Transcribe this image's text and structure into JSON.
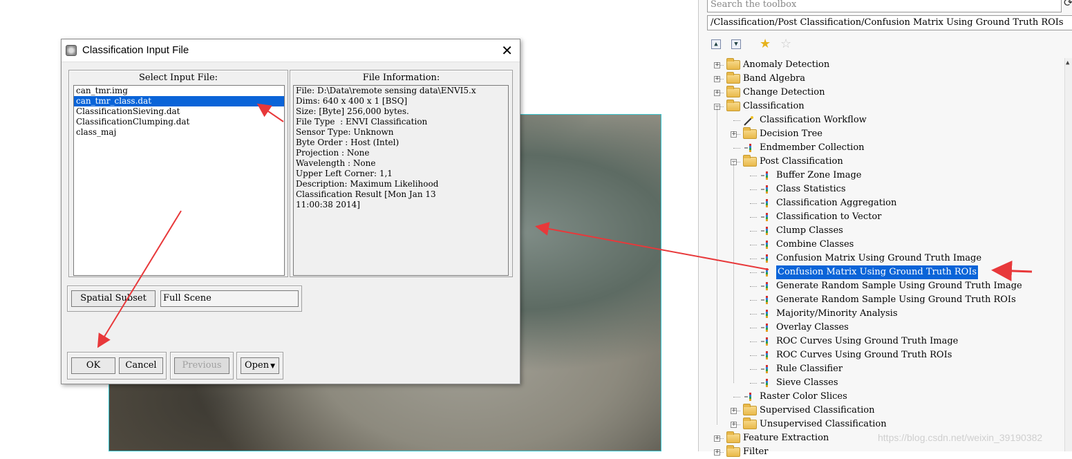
{
  "dialog": {
    "title": "Classification Input File",
    "select_header": "Select Input File:",
    "files": [
      "can_tmr.img",
      "can_tmr_class.dat",
      "ClassificationSieving.dat",
      "ClassificationClumping.dat",
      "class_maj"
    ],
    "selected_index": 1,
    "info_header": "File Information:",
    "info_lines": [
      "File: D:\\Data\\remote sensing data\\ENVI5.x",
      "Dims: 640 x 400 x 1 [BSQ]",
      "Size: [Byte] 256,000 bytes.",
      "File Type  : ENVI Classification",
      "Sensor Type: Unknown",
      "Byte Order : Host (Intel)",
      "Projection : None",
      "Wavelength : None",
      "Upper Left Corner: 1,1",
      "Description: Maximum Likelihood",
      "Classification Result [Mon Jan 13",
      "11:00:38 2014]"
    ],
    "spatial_subset_label": "Spatial Subset",
    "spatial_subset_value": "Full Scene",
    "ok_label": "OK",
    "cancel_label": "Cancel",
    "previous_label": "Previous",
    "open_label": "Open"
  },
  "toolbox": {
    "search_placeholder": "Search the toolbox",
    "path": "/Classification/Post Classification/Confusion Matrix Using Ground Truth ROIs",
    "items": [
      {
        "label": "Anomaly Detection",
        "level": 0,
        "kind": "folder",
        "expander": "+"
      },
      {
        "label": "Band Algebra",
        "level": 0,
        "kind": "folder",
        "expander": "+"
      },
      {
        "label": "Change Detection",
        "level": 0,
        "kind": "folder",
        "expander": "+"
      },
      {
        "label": "Classification",
        "level": 0,
        "kind": "folder",
        "expander": "-"
      },
      {
        "label": "Classification Workflow",
        "level": 1,
        "kind": "wand"
      },
      {
        "label": "Decision Tree",
        "level": 1,
        "kind": "folder",
        "expander": "+"
      },
      {
        "label": "Endmember Collection",
        "level": 1,
        "kind": "tool"
      },
      {
        "label": "Post Classification",
        "level": 1,
        "kind": "folder",
        "expander": "-"
      },
      {
        "label": "Buffer Zone Image",
        "level": 2,
        "kind": "tool"
      },
      {
        "label": "Class Statistics",
        "level": 2,
        "kind": "tool"
      },
      {
        "label": "Classification Aggregation",
        "level": 2,
        "kind": "tool"
      },
      {
        "label": "Classification to Vector",
        "level": 2,
        "kind": "tool"
      },
      {
        "label": "Clump Classes",
        "level": 2,
        "kind": "tool"
      },
      {
        "label": "Combine Classes",
        "level": 2,
        "kind": "tool"
      },
      {
        "label": "Confusion Matrix Using Ground Truth Image",
        "level": 2,
        "kind": "tool"
      },
      {
        "label": "Confusion Matrix Using Ground Truth ROIs",
        "level": 2,
        "kind": "tool",
        "selected": true
      },
      {
        "label": "Generate Random Sample Using Ground Truth Image",
        "level": 2,
        "kind": "tool"
      },
      {
        "label": "Generate Random Sample Using Ground Truth ROIs",
        "level": 2,
        "kind": "tool"
      },
      {
        "label": "Majority/Minority Analysis",
        "level": 2,
        "kind": "tool"
      },
      {
        "label": "Overlay Classes",
        "level": 2,
        "kind": "tool"
      },
      {
        "label": "ROC Curves Using Ground Truth Image",
        "level": 2,
        "kind": "tool"
      },
      {
        "label": "ROC Curves Using Ground Truth ROIs",
        "level": 2,
        "kind": "tool"
      },
      {
        "label": "Rule Classifier",
        "level": 2,
        "kind": "tool"
      },
      {
        "label": "Sieve Classes",
        "level": 2,
        "kind": "tool"
      },
      {
        "label": "Raster Color Slices",
        "level": 1,
        "kind": "tool"
      },
      {
        "label": "Supervised Classification",
        "level": 1,
        "kind": "folder",
        "expander": "+"
      },
      {
        "label": "Unsupervised Classification",
        "level": 1,
        "kind": "folder",
        "expander": "+"
      },
      {
        "label": "Feature Extraction",
        "level": 0,
        "kind": "folder",
        "expander": "+"
      },
      {
        "label": "Filter",
        "level": 0,
        "kind": "folder",
        "expander": "+"
      }
    ]
  },
  "watermark": "https://blog.csdn.net/weixin_39190382",
  "colors": {
    "selection": "#0a64d8",
    "annotation_arrow": "#e8383a",
    "image_border": "#38c6d0"
  }
}
